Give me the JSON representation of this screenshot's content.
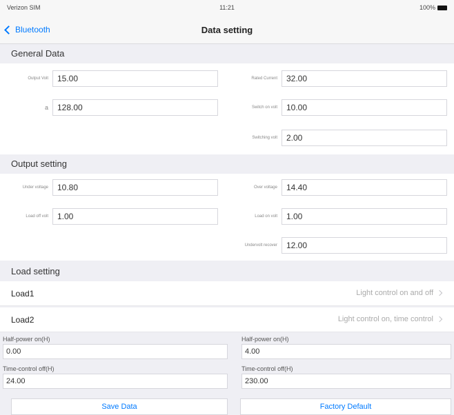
{
  "status_bar": {
    "carrier": "Verizon SIM",
    "time": "11:21",
    "battery": "100%"
  },
  "nav": {
    "back_label": "Bluetooth",
    "title": "Data setting"
  },
  "general": {
    "header": "General Data",
    "fields": [
      {
        "label": "Output Volt",
        "value": "15.00"
      },
      {
        "label": "Rated Current",
        "value": "32.00"
      },
      {
        "label": "a",
        "value": "128.00"
      },
      {
        "label": "Switch on volt",
        "value": "10.00"
      },
      {
        "label": "Switching volt",
        "value": "2.00"
      }
    ]
  },
  "output": {
    "header": "Output setting",
    "fields": [
      {
        "label": "Under voltage",
        "value": "10.80"
      },
      {
        "label": "Over voltage",
        "value": "14.40"
      },
      {
        "label": "Load off volt",
        "value": "1.00"
      },
      {
        "label": "Load on volt",
        "value": "1.00"
      },
      {
        "label": "Undervolt recover",
        "value": "12.00"
      }
    ]
  },
  "load": {
    "header": "Load setting",
    "load1": {
      "label": "Load1",
      "value": "Light control on and off"
    },
    "load2": {
      "label": "Load2",
      "value": "Light control on, time control"
    },
    "half_power_on": {
      "label": "Half-power on(H)",
      "value": "0.00"
    },
    "half_power_on2": {
      "label": "Half-power on(H)",
      "value": "4.00"
    },
    "time_control_off": {
      "label": "Time-control off(H)",
      "value": "24.00"
    },
    "time_control_off2": {
      "label": "Time-control off(H)",
      "value": "230.00"
    }
  },
  "buttons": {
    "save": "Save Data",
    "factory": "Factory Default"
  }
}
